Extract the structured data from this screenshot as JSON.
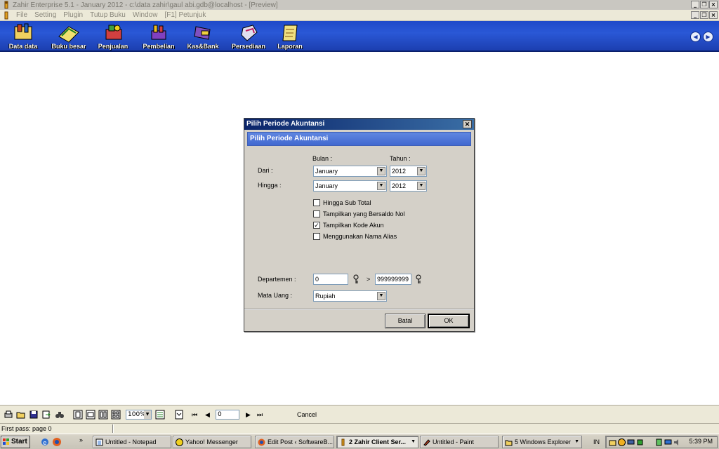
{
  "window": {
    "title": "Zahir Enterprise 5.1 - January 2012 - c:\\data zahir\\gaul abi.gdb@localhost - [Preview]"
  },
  "menu": {
    "items": [
      "File",
      "Setting",
      "Plugin",
      "Tutup Buku",
      "Window",
      "[F1] Petunjuk"
    ]
  },
  "toolbar": {
    "items": [
      {
        "label": "Data data",
        "icon": "data-icon"
      },
      {
        "label": "Buku besar",
        "icon": "ledger-icon"
      },
      {
        "label": "Penjualan",
        "icon": "sales-icon"
      },
      {
        "label": "Pembelian",
        "icon": "purchase-icon"
      },
      {
        "label": "Kas&Bank",
        "icon": "cashbank-icon"
      },
      {
        "label": "Persediaan",
        "icon": "inventory-icon"
      },
      {
        "label": "Laporan",
        "icon": "report-icon"
      }
    ]
  },
  "dialog": {
    "title": "Pilih Periode Akuntansi",
    "header": "Pilih Periode Akuntansi",
    "col_bulan": "Bulan :",
    "col_tahun": "Tahun :",
    "dari_label": "Dari :",
    "hingga_label": "Hingga :",
    "dari_bulan": "January",
    "dari_tahun": "2012",
    "hingga_bulan": "January",
    "hingga_tahun": "2012",
    "checkboxes": [
      {
        "label": "Hingga Sub Total",
        "checked": false
      },
      {
        "label": "Tampilkan yang Bersaldo Nol",
        "checked": false
      },
      {
        "label": "Tampilkan Kode Akun",
        "checked": true
      },
      {
        "label": "Menggunakan Nama Alias",
        "checked": false
      }
    ],
    "departemen_label": "Departemen :",
    "departemen_from": "0",
    "departemen_sep": ">",
    "departemen_to": "999999999",
    "mata_uang_label": "Mata Uang :",
    "mata_uang_value": "Rupiah",
    "batal_label": "Batal",
    "ok_label": "OK"
  },
  "preview": {
    "zoom": "100%",
    "page": "0",
    "cancel_label": "Cancel"
  },
  "status": {
    "text": "First pass: page 0"
  },
  "taskbar": {
    "start_label": "Start",
    "quicklaunch_more": "»",
    "tasks": [
      {
        "label": "Untitled - Notepad",
        "active": false
      },
      {
        "label": "Yahoo! Messenger",
        "active": false
      },
      {
        "label": "Edit Post ‹ SoftwareB...",
        "active": false
      },
      {
        "label": "2 Zahir Client Ser...",
        "active": true
      },
      {
        "label": "Untitled - Paint",
        "active": false
      },
      {
        "label": "5 Windows Explorer",
        "active": false
      }
    ],
    "language": "IN",
    "clock": "5:39 PM"
  },
  "colors": {
    "toolbar_blue": "#2a58d6",
    "dialog_title": "#0a246a",
    "dialog_header": "#4168d0"
  }
}
